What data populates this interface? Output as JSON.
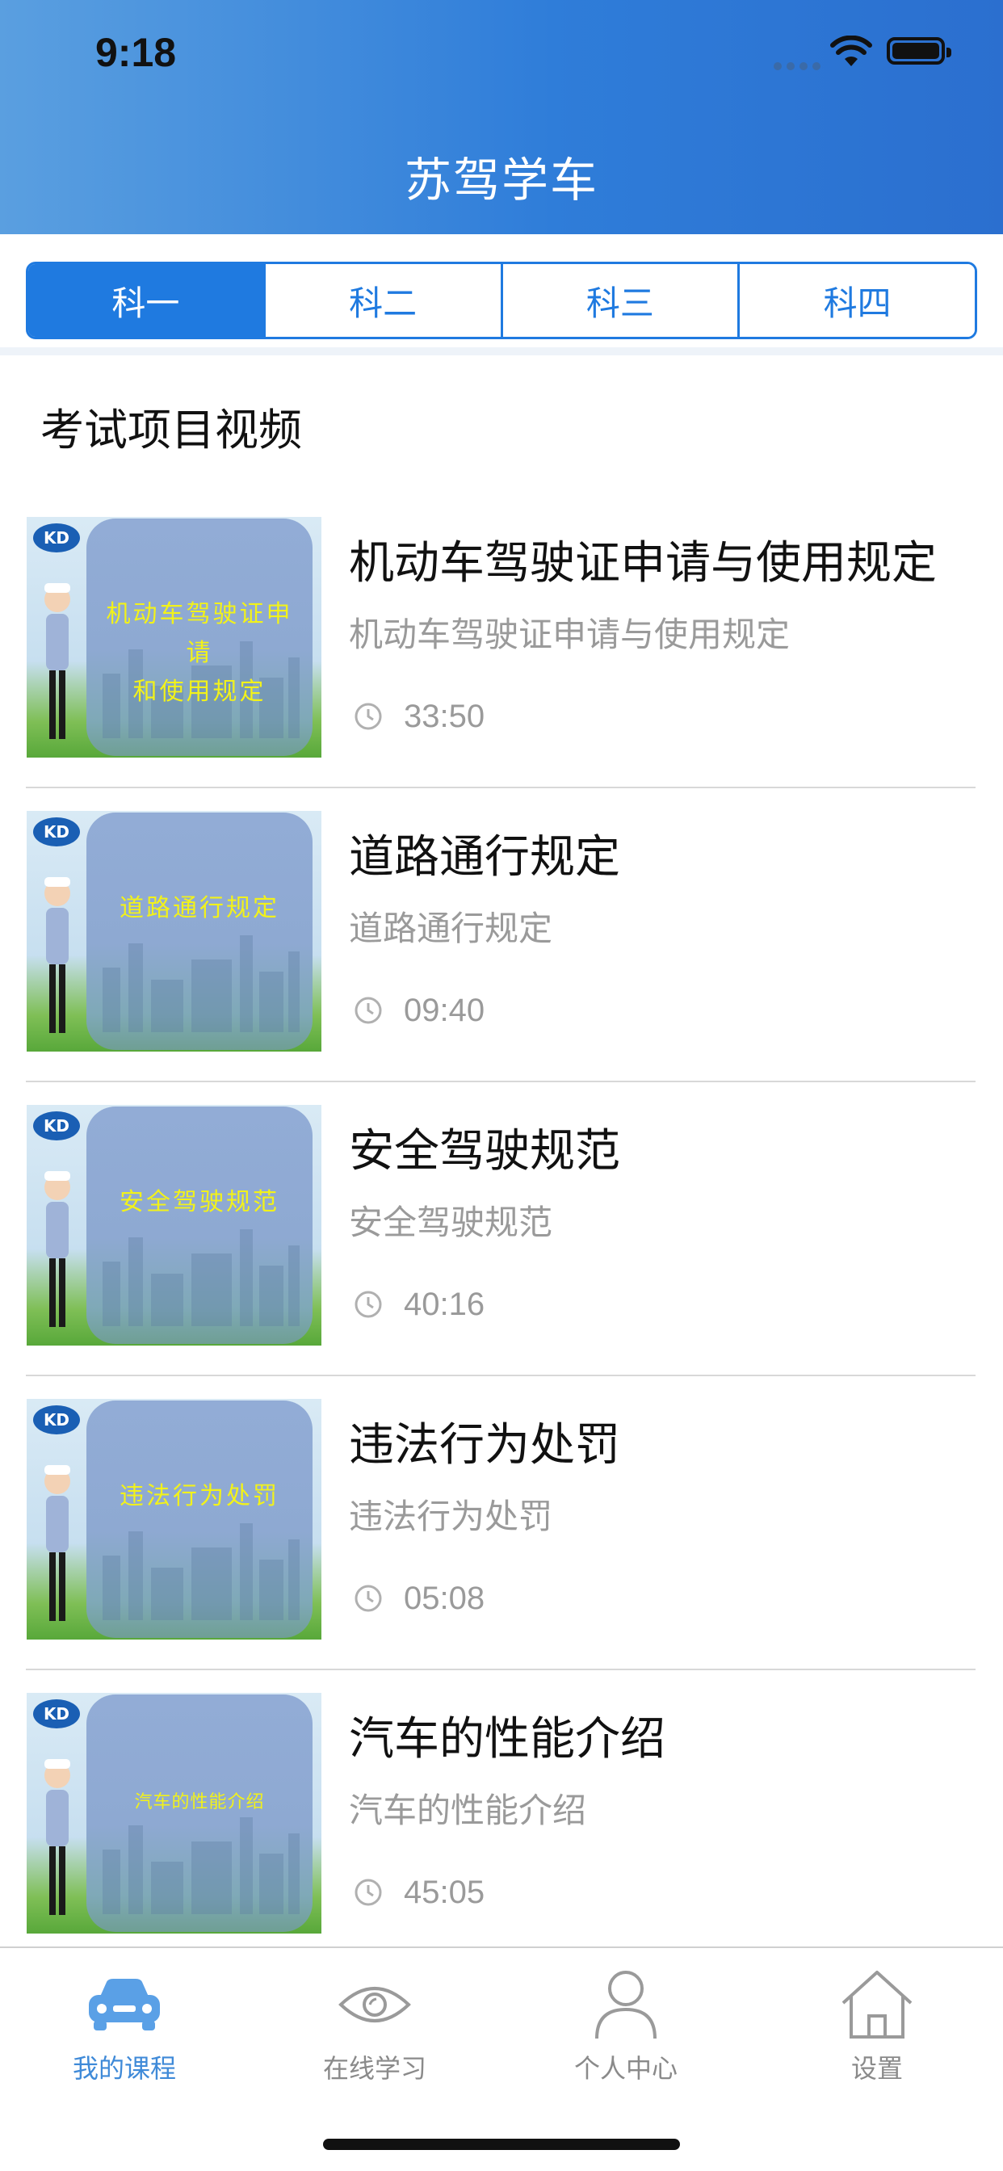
{
  "status_bar": {
    "time": "9:18"
  },
  "header": {
    "title": "苏驾学车"
  },
  "tabs": [
    {
      "label": "科一",
      "active": true
    },
    {
      "label": "科二",
      "active": false
    },
    {
      "label": "科三",
      "active": false
    },
    {
      "label": "科四",
      "active": false
    }
  ],
  "section": {
    "title": "考试项目视频"
  },
  "videos": [
    {
      "title": "机动车驾驶证申请与使用规定",
      "subtitle": "机动车驾驶证申请与使用规定",
      "duration": "33:50",
      "thumb_caption": "机动车驾驶证申请\n和使用规定",
      "thumb_logo": "KD"
    },
    {
      "title": "道路通行规定",
      "subtitle": "道路通行规定",
      "duration": "09:40",
      "thumb_caption": "道路通行规定",
      "thumb_logo": "KD"
    },
    {
      "title": "安全驾驶规范",
      "subtitle": "安全驾驶规范",
      "duration": "40:16",
      "thumb_caption": "安全驾驶规范",
      "thumb_logo": "KD"
    },
    {
      "title": "违法行为处罚",
      "subtitle": "违法行为处罚",
      "duration": "05:08",
      "thumb_caption": "违法行为处罚",
      "thumb_logo": "KD"
    },
    {
      "title": "汽车的性能介绍",
      "subtitle": "汽车的性能介绍",
      "duration": "45:05",
      "thumb_caption": "汽车的性能介绍",
      "thumb_logo": "KD"
    }
  ],
  "tabbar": [
    {
      "label": "我的课程",
      "icon": "car-icon",
      "active": true
    },
    {
      "label": "在线学习",
      "icon": "eye-icon",
      "active": false
    },
    {
      "label": "个人中心",
      "icon": "person-icon",
      "active": false
    },
    {
      "label": "设置",
      "icon": "home-icon",
      "active": false
    }
  ],
  "colors": {
    "accent": "#1f7ae0",
    "header_start": "#5a9fe0",
    "header_end": "#2b6fcf",
    "muted_text": "#9a9a9a",
    "caption_yellow": "#f2f21a"
  }
}
